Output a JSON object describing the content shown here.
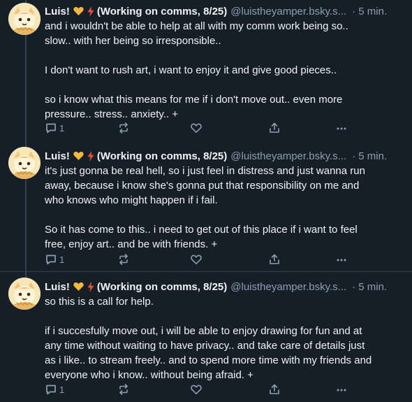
{
  "posts": [
    {
      "author_name": "Luis!",
      "author_display_suffix": "(Working on comms, 8/25)",
      "handle": "@luistheyamper.bsky.s...",
      "time": "· 5 min.",
      "body": "and i wouldn't be able to help at all with my comm work being so..\nslow.. with her being so irresponsible..\n\nI don't want to rush art, i want to enjoy it and give good pieces..\n\nso i know what this means for me if i don't move out.. even more\npressure.. stress.. anxiety.. +",
      "reply_count": "1"
    },
    {
      "author_name": "Luis!",
      "author_display_suffix": "(Working on comms, 8/25)",
      "handle": "@luistheyamper.bsky.s...",
      "time": "· 5 min.",
      "body": "it's just gonna be real hell, so i just feel in distress and just wanna run\naway, because i know she's gonna put that responsibility on me and\nwho knows who might happen if i fail.\n\nSo it has come to this.. i need to get out of this place if i want to feel\nfree, enjoy art.. and be with friends. +",
      "reply_count": "1"
    },
    {
      "author_name": "Luis!",
      "author_display_suffix": "(Working on comms, 8/25)",
      "handle": "@luistheyamper.bsky.s...",
      "time": "· 5 min.",
      "body": "so this is a call for help.\n\nif i succesfully move out, i will be able to enjoy drawing for fun and at\nany time without waiting to have privacy.. and take care of details just\nas i like.. to stream freely.. and to spend more time with my friends and\neveryone who i know.. without being afraid. +",
      "reply_count": "1"
    }
  ],
  "icons": {
    "heart_emoji": "yellow-heart-icon",
    "bolt_emoji": "lightning-icon",
    "reply": "reply-icon",
    "repost": "repost-icon",
    "like": "like-icon",
    "share": "share-icon",
    "more": "more-icon"
  },
  "colors": {
    "background": "#161e27",
    "text": "#f1f3f5",
    "muted": "#8d9fb2",
    "divider": "#2e4052",
    "heart": "#f6b73c",
    "bolt": "#e8513a"
  }
}
